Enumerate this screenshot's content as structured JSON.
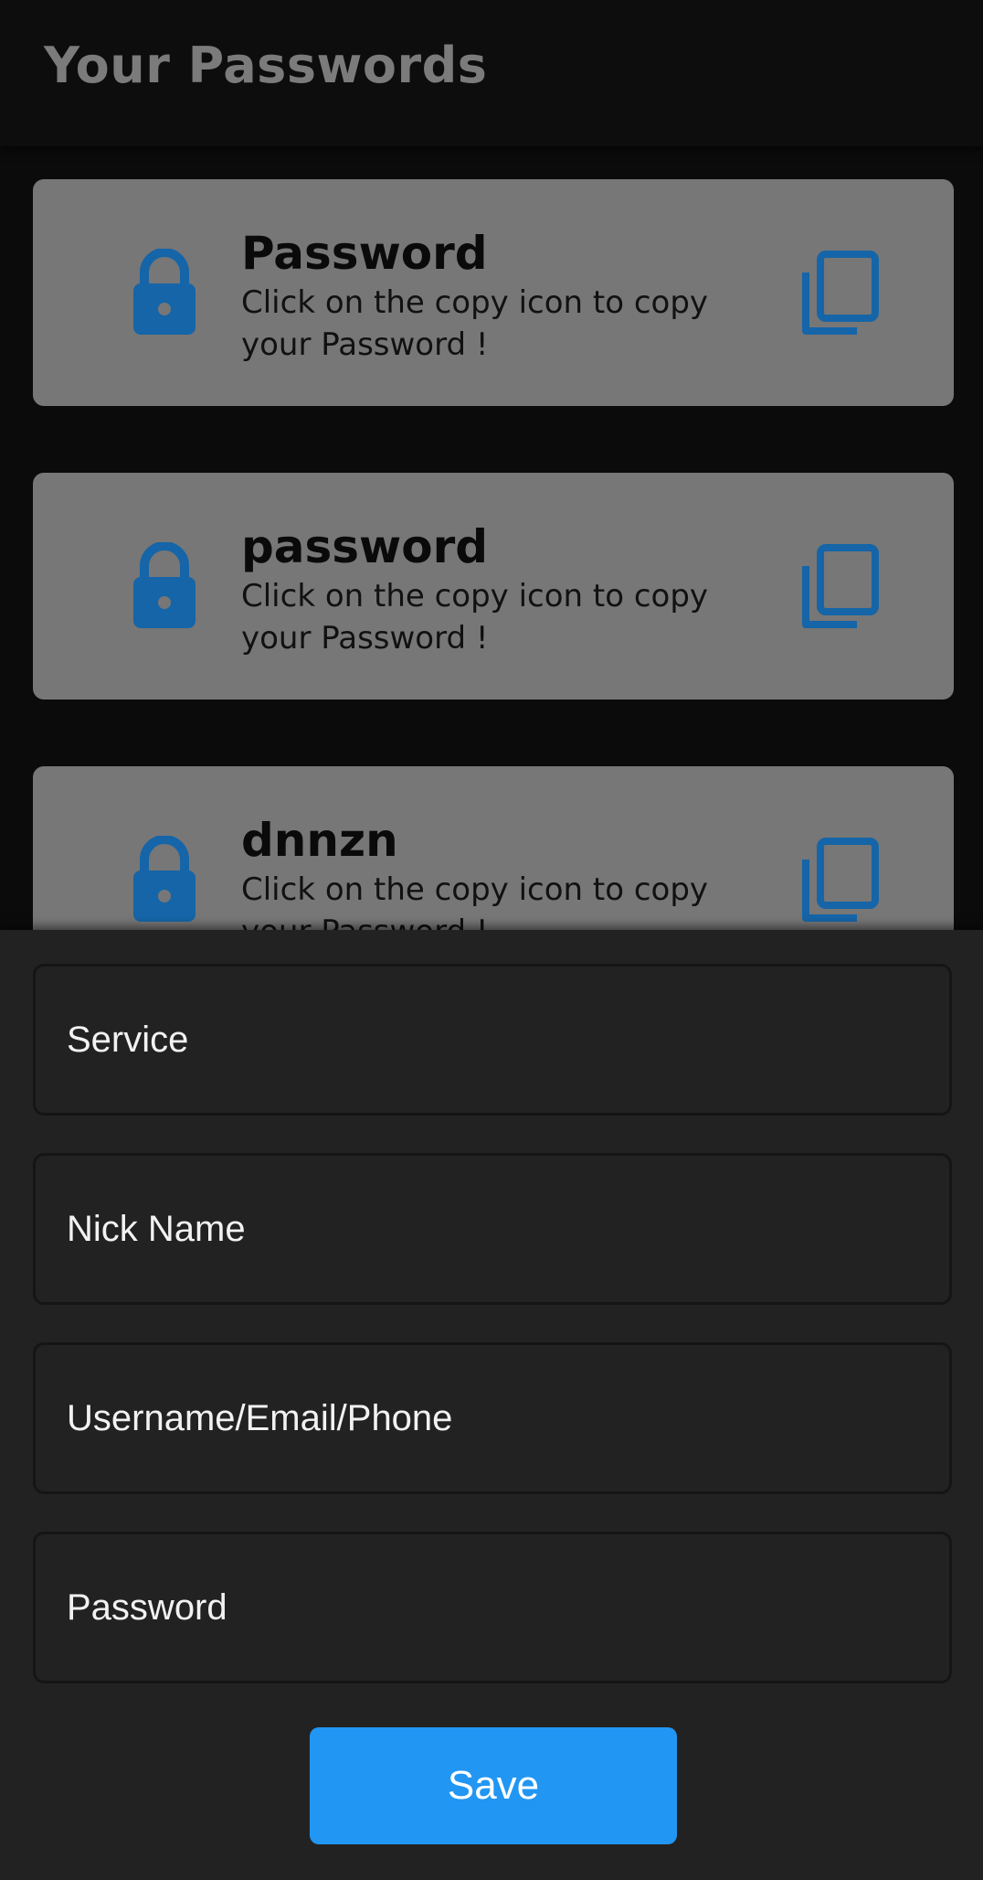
{
  "app_bar": {
    "title": "Your Passwords"
  },
  "colors": {
    "accent": "#2196f3",
    "icon_blue": "#1565a8",
    "card_bg": "#777777",
    "sheet_bg": "#222222"
  },
  "password_list": {
    "items": [
      {
        "title": "Password",
        "description": "Click on the copy icon to copy your Password !",
        "leading_icon": "lock-icon",
        "trailing_icon": "copy-icon"
      },
      {
        "title": "password",
        "description": "Click on the copy icon to copy your Password !",
        "leading_icon": "lock-icon",
        "trailing_icon": "copy-icon"
      },
      {
        "title": "dnnzn",
        "description": "Click on the copy icon to copy your Password !",
        "leading_icon": "lock-icon",
        "trailing_icon": "copy-icon"
      }
    ]
  },
  "form": {
    "service": {
      "placeholder": "Service",
      "value": ""
    },
    "nickname": {
      "placeholder": "Nick Name",
      "value": ""
    },
    "username": {
      "placeholder": "Username/Email/Phone",
      "value": ""
    },
    "password": {
      "placeholder": "Password",
      "value": ""
    },
    "save_label": "Save"
  }
}
